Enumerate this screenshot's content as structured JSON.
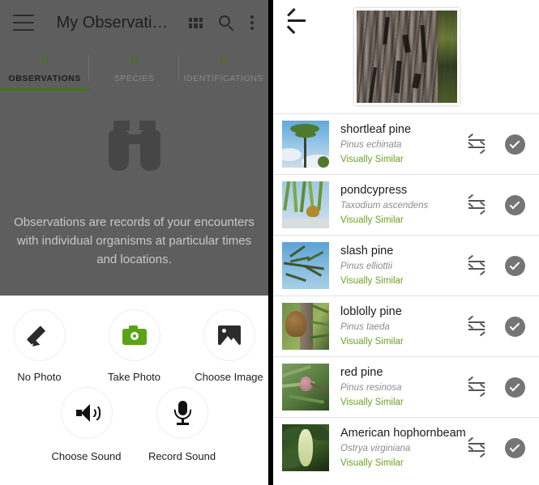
{
  "left": {
    "appbar": {
      "menu_icon": "hamburger-icon",
      "title": "My Observati…",
      "grid_icon": "grid-view-icon",
      "search_icon": "search-icon",
      "overflow_icon": "more-vertical-icon"
    },
    "tabs": [
      {
        "count": "0",
        "label": "OBSERVATIONS",
        "active": true
      },
      {
        "count": "0",
        "label": "SPECIES",
        "active": false
      },
      {
        "count": "0",
        "label": "IDENTIFICATIONS",
        "active": false
      }
    ],
    "empty_state": {
      "icon": "binoculars-icon",
      "text": "Observations are records of your encounters with individual organisms at particular times and locations."
    },
    "sheet": {
      "row1": [
        {
          "label": "No Photo",
          "icon": "pencil-icon"
        },
        {
          "label": "Take Photo",
          "icon": "camera-icon"
        },
        {
          "label": "Choose Image",
          "icon": "image-icon"
        }
      ],
      "row2": [
        {
          "label": "Choose Sound",
          "icon": "speaker-icon"
        },
        {
          "label": "Record Sound",
          "icon": "microphone-icon"
        }
      ]
    }
  },
  "right": {
    "header": {
      "back_icon": "back-arrow-icon",
      "photo_alt": "tree-bark-photo"
    },
    "rows": [
      {
        "common": "shortleaf pine",
        "sci": "Pinus echinata",
        "badge": "Visually Similar",
        "thumb": "pine-tree-sky",
        "compare_icon": "compare-arrows-icon",
        "select_icon": "check-circle-icon"
      },
      {
        "common": "pondcypress",
        "sci": "Taxodium ascendens",
        "badge": "Visually Similar",
        "thumb": "cypress-foliage",
        "compare_icon": "compare-arrows-icon",
        "select_icon": "check-circle-icon"
      },
      {
        "common": "slash pine",
        "sci": "Pinus elliottii",
        "badge": "Visually Similar",
        "thumb": "pine-needles-sky",
        "compare_icon": "compare-arrows-icon",
        "select_icon": "check-circle-icon"
      },
      {
        "common": "loblolly pine",
        "sci": "Pinus taeda",
        "badge": "Visually Similar",
        "thumb": "pine-cone",
        "compare_icon": "compare-arrows-icon",
        "select_icon": "check-circle-icon"
      },
      {
        "common": "red pine",
        "sci": "Pinus resinosa",
        "badge": "Visually Similar",
        "thumb": "red-pine-cone",
        "compare_icon": "compare-arrows-icon",
        "select_icon": "check-circle-icon"
      },
      {
        "common": "American hophornbeam",
        "sci": "Ostrya virginiana",
        "badge": "Visually Similar",
        "thumb": "hophornbeam-catkin",
        "compare_icon": "compare-arrows-icon",
        "select_icon": "check-circle-icon"
      }
    ]
  },
  "colors": {
    "accent_green": "#44740f",
    "badge_green": "#6f9f26",
    "camera_green": "#5aa316",
    "scrim_gray": "#5e5e5e",
    "check_gray": "#757575"
  }
}
